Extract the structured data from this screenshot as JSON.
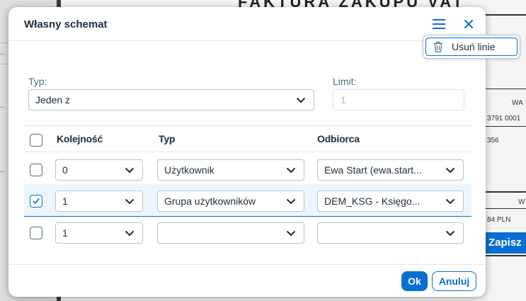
{
  "background": {
    "doc_title": "FAKTURA ZAKUPU VAT ",
    "fragments": [
      "WA",
      "3791 0001",
      "356",
      "84 PLN",
      "W"
    ],
    "side_dots": [
      "..",
      "..",
      ".."
    ],
    "save_label": "Zapisz"
  },
  "dialog": {
    "title": "Własny schemat",
    "menu_icon": "hamburger-menu-icon",
    "close_icon": "close-icon",
    "type_label": "Typ:",
    "type_value": "Jeden z",
    "limit_label": "Limit:",
    "limit_value": "1",
    "columns": {
      "order": "Kolejność",
      "type": "Typ",
      "recipient": "Odbiorca"
    },
    "rows": [
      {
        "checked": false,
        "order": "0",
        "type": "Użytkownik",
        "recipient": "Ewa Start (ewa.start..."
      },
      {
        "checked": true,
        "order": "1",
        "type": "Grupa użytkowników",
        "recipient": "DEM_KSG - Księgo..."
      },
      {
        "checked": false,
        "order": "1",
        "type": "",
        "recipient": ""
      }
    ],
    "ok_label": "Ok",
    "cancel_label": "Anuluj"
  },
  "popover": {
    "item_icon": "trash-icon",
    "item_label": "Usuń linie"
  },
  "colors": {
    "accent": "#0a6ed1",
    "text": "#1d2d3e",
    "selected_row": "#ebf5fe"
  }
}
